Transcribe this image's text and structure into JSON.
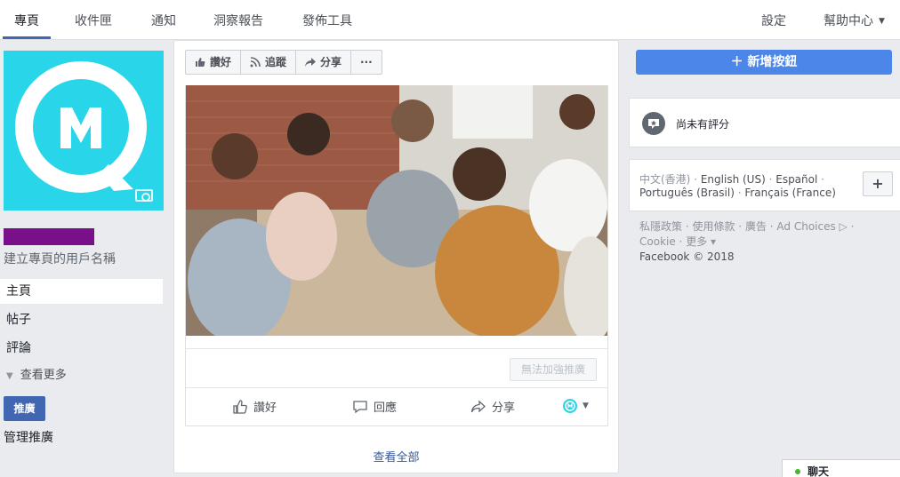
{
  "topnav": {
    "tabs": [
      "專頁",
      "收件匣",
      "通知",
      "洞察報告",
      "發佈工具"
    ],
    "settings": "設定",
    "help": "幫助中心"
  },
  "left": {
    "username_prompt": "建立專頁的用戶名稱",
    "nav": [
      "主頁",
      "帖子",
      "評論"
    ],
    "see_more": "查看更多",
    "promote": "推廣",
    "manage_promotions": "管理推廣"
  },
  "actions": {
    "like": "讚好",
    "follow": "追蹤",
    "share": "分享",
    "more": "···"
  },
  "post": {
    "boost": "無法加強推廣",
    "like": "讚好",
    "comment": "回應",
    "share": "分享"
  },
  "see_all": "查看全部",
  "right": {
    "cta": "＋ 新增按鈕",
    "rating": "尚未有評分",
    "lang_current": "中文(香港)",
    "langs": [
      "English (US)",
      "Español",
      "Português (Brasil)",
      "Français (France)"
    ],
    "add_lang": "+",
    "footer_links": [
      "私隱政策",
      "使用條款",
      "廣告",
      "Ad Choices",
      "Cookie",
      "更多"
    ],
    "copyright": "Facebook © 2018"
  },
  "chat": "聊天",
  "colors": {
    "brand_blue": "#4267b2",
    "cta_blue": "#4b86e8",
    "avatar_cyan": "#29d5e8",
    "online_green": "#42b72a"
  }
}
